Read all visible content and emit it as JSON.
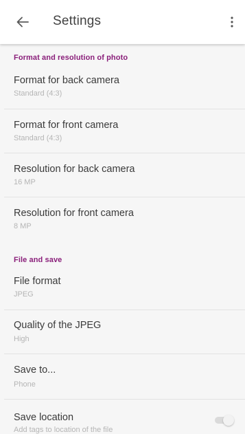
{
  "app_bar": {
    "back_icon": "arrow-left-icon",
    "title": "Settings",
    "overflow_icon": "more-vertical-icon"
  },
  "colors": {
    "section_header": "#8a1f7a",
    "background": "#f6f6f6",
    "app_bar": "#ffffff"
  },
  "sections": [
    {
      "header": "Format and resolution of photo",
      "items": [
        {
          "title": "Format for back camera",
          "summary": "Standard (4:3)"
        },
        {
          "title": "Format for front camera",
          "summary": "Standard (4:3)"
        },
        {
          "title": "Resolution for back camera",
          "summary": "16 MP"
        },
        {
          "title": "Resolution for front camera",
          "summary": "8 MP"
        }
      ]
    },
    {
      "header": "File and save",
      "items": [
        {
          "title": "File format",
          "summary": "JPEG"
        },
        {
          "title": "Quality of the JPEG",
          "summary": "High"
        },
        {
          "title": "Save to...",
          "summary": "Phone"
        },
        {
          "title": "Save location",
          "summary": "Add tags to location of the file",
          "toggle": "off"
        }
      ]
    }
  ]
}
